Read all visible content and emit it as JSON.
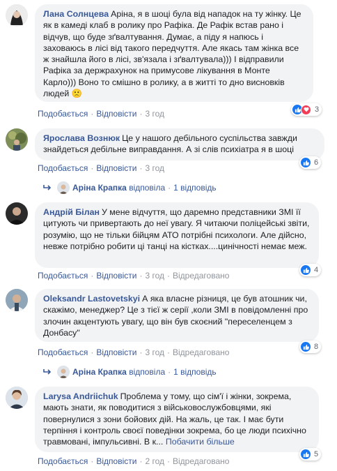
{
  "comments": [
    {
      "author": "Лана Солнцева",
      "text": "Аріна, я в шоці була від нападок на ту жінку. Це як в камеді клаб в ролику про Рафіка. Де Рафік встав рано і відчув, що буде зґвалтування. Думає, а піду я напюсь і заховаюсь в лісі від такого передчуття. Але якась там жінка все ж знайшла його в лісі, зв'язала і зґвалтувала))) І відправили Рафіка за держрахунок на примусове лікування в Монте Карло))) Воно то смішно в ролику, а в житті то дно висновків людей",
      "emoji": "🙁",
      "reactions": "3",
      "like": "Подобається",
      "reply": "Відповісти",
      "time": "3 год",
      "edited": ""
    },
    {
      "author": "Ярослава Вознюк",
      "text": "Це у нашого дебільного суспільства завжди знайдеться дебільне виправдання. А зі слів психіатра я в шоці",
      "reactions": "6",
      "like": "Подобається",
      "reply": "Відповісти",
      "time": "3 год",
      "edited": ""
    },
    {
      "author": "Андрій Білан",
      "text": "У мене відчуття, що даремно представники ЗМІ її цитують чи привертають до неї увагу. Я читаючи поліцейські звіти, розумію, що не тільки бійцям АТО потрібні психологи. Але дійсно, невже потрібно робити ці танці на кістках....цинічності немає меж.",
      "reactions": "4",
      "like": "Подобається",
      "reply": "Відповісти",
      "time": "3 год",
      "edited": "Відредаговано"
    },
    {
      "author": "Oleksandr Lastovetskyi",
      "text": "А яка власне різниця, це був атошник чи, скажімо, менеджер? Це з тієї ж серії ,коли ЗМІ в повідомленні про злочин акцентують увагу, що він був скоєний \"переселенцем з Донбасу\"",
      "reactions": "8",
      "like": "Подобається",
      "reply": "Відповісти",
      "time": "3 год",
      "edited": "Відредаговано"
    },
    {
      "author": "Larysa Andriichuk",
      "text": "Проблема у тому, що сім'ї і жінки, зокрема, мають знати, як поводитися з військовослужбовцями, які повернулися з зони бойових дій. На жаль, це так. І має бути терпіння і контроль своєї поведінки зокрема, бо це люди психічно травмовані, імпульсивні. В к...",
      "see_more": "Побачити більше",
      "reactions": "5",
      "like": "Подобається",
      "reply": "Відповісти",
      "time": "2 год",
      "edited": "Відредаговано"
    }
  ],
  "reply_rows": [
    {
      "author": "Аріна Крапка",
      "action": "відповіла",
      "count": "1 відповідь"
    },
    {
      "author": "Аріна Крапка",
      "action": "відповіла",
      "count": "1 відповідь"
    }
  ],
  "separator": "·",
  "colors": {
    "link": "#385898",
    "bubble": "#f2f3f5",
    "like_blue": "#1877f2",
    "love_red": "#f33e58"
  }
}
